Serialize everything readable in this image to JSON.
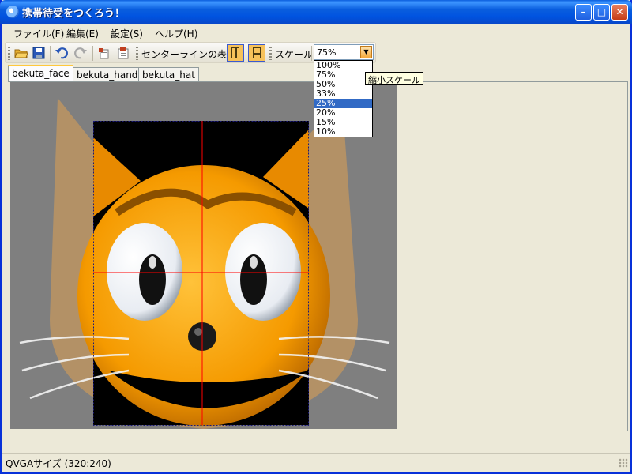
{
  "window": {
    "title": "携帯待受をつくろう！",
    "min_glyph": "–",
    "max_glyph": "□",
    "close_glyph": "✕"
  },
  "menu": {
    "items": [
      "ファイル(F)",
      "編集(E)",
      "設定(S)",
      "ヘルプ(H)"
    ]
  },
  "toolbar": {
    "centerline_label": "センターラインの表示",
    "scale_label": "スケール",
    "scale_value": "75%",
    "icons": [
      "open-folder-icon",
      "save-icon",
      "undo-icon",
      "redo-icon",
      "copy-icon",
      "paste-icon"
    ]
  },
  "scale_dropdown": {
    "options": [
      "100%",
      "75%",
      "50%",
      "33%",
      "25%",
      "20%",
      "15%",
      "10%"
    ],
    "highlighted": "25%",
    "tooltip": "縮小スケール"
  },
  "tabs": [
    "bekuta_face",
    "bekuta_hand",
    "bekuta_hat"
  ],
  "status": {
    "text": "QVGAサイズ (320:240)"
  },
  "colors": {
    "titlebar": "#0a5ede",
    "highlight": "#316ac5",
    "centerline": "#ff0000",
    "canvas": "#7f7f7f",
    "cat_orange": "#f59a00"
  }
}
